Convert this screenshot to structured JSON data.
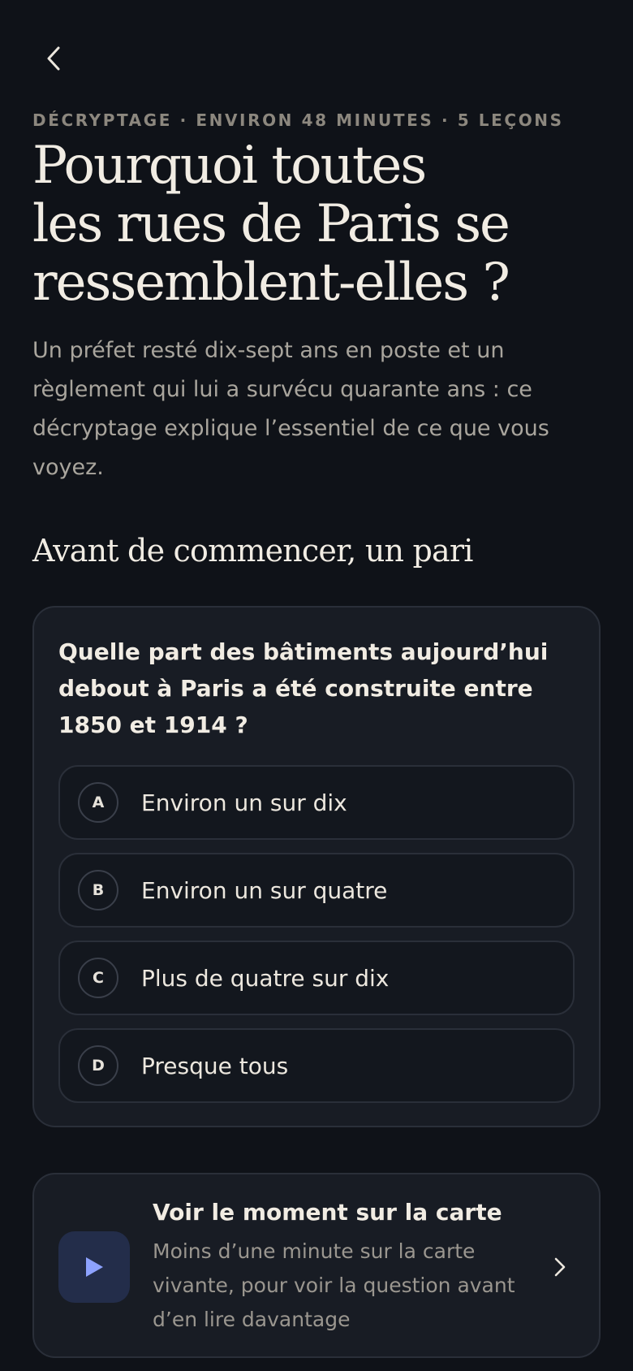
{
  "header": {
    "back_icon": "chevron-left-icon",
    "meta": "DÉCRYPTAGE · ENVIRON 48 MINUTES · 5 LEÇONS",
    "title_lines": [
      "Pourquoi toutes",
      "les rues de Paris se",
      "ressemblent-elles ?"
    ],
    "intro": "Un préfet resté dix-sept ans en poste et un règlement qui lui a survécu quarante ans : ce décryptage explique l’essentiel de ce que vous voyez."
  },
  "section": {
    "heading": "Avant de commencer, un pari"
  },
  "quiz": {
    "question": "Quelle part des bâtiments aujourd’hui debout à Paris a été construite entre 1850 et 1914 ?",
    "options": [
      {
        "letter": "A",
        "text": "Environ un sur dix"
      },
      {
        "letter": "B",
        "text": "Environ un sur quatre"
      },
      {
        "letter": "C",
        "text": "Plus de quatre sur dix"
      },
      {
        "letter": "D",
        "text": "Presque tous"
      }
    ]
  },
  "map_card": {
    "title": "Voir le moment sur la carte",
    "description": "Moins d’une minute sur la carte vivante, pour voir la question avant d’en lire davantage",
    "play_icon": "play-icon",
    "arrow_icon": "chevron-right-icon"
  },
  "colors": {
    "background": "#0f1218",
    "card": "#181c24",
    "accent_tile": "#232d4a",
    "play": "#8da2ff",
    "text_primary": "#f1ece3",
    "text_muted": "#a9a59d"
  }
}
